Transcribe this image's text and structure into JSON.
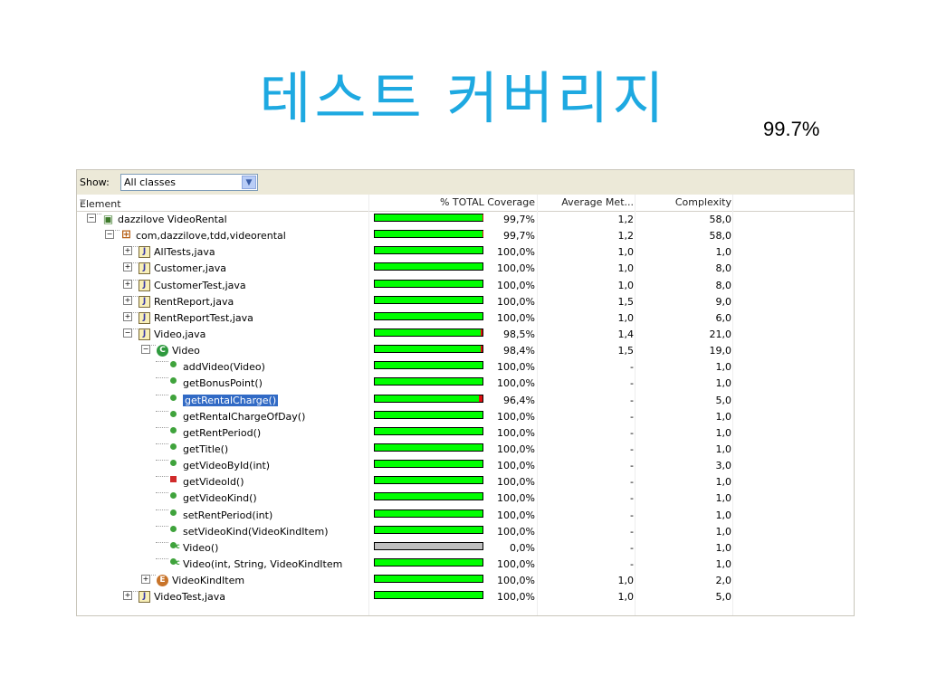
{
  "title": "테스트 커버리지",
  "overall_coverage": "99.7%",
  "show": {
    "label": "Show:",
    "value": "All classes",
    "dropdown_icon": "chevron-down-icon"
  },
  "columns": {
    "element": "Element",
    "coverage": "% TOTAL Coverage",
    "average": "Average Met...",
    "complexity": "Complexity"
  },
  "colors": {
    "title": "#1ea9e1",
    "covered": "#00ff00",
    "missed": "#dd1111",
    "not_covered": "#c0c0c0",
    "selection": "#316ac5"
  },
  "rows": [
    {
      "name": "dazzilove VideoRental",
      "icon": "project-icon",
      "level": 0,
      "expander": "minus",
      "coverage_value": 99.7,
      "coverage": "99,7%",
      "average": "1,2",
      "complexity": "58,0"
    },
    {
      "name": "com,dazzilove,tdd,videorental",
      "icon": "package-icon",
      "level": 1,
      "expander": "minus",
      "coverage_value": 99.7,
      "coverage": "99,7%",
      "average": "1,2",
      "complexity": "58,0"
    },
    {
      "name": "AllTests,java",
      "icon": "java-file-icon",
      "level": 2,
      "expander": "plus",
      "coverage_value": 100,
      "coverage": "100,0%",
      "average": "1,0",
      "complexity": "1,0"
    },
    {
      "name": "Customer,java",
      "icon": "java-file-icon",
      "level": 2,
      "expander": "plus",
      "coverage_value": 100,
      "coverage": "100,0%",
      "average": "1,0",
      "complexity": "8,0"
    },
    {
      "name": "CustomerTest,java",
      "icon": "java-file-icon",
      "level": 2,
      "expander": "plus",
      "coverage_value": 100,
      "coverage": "100,0%",
      "average": "1,0",
      "complexity": "8,0"
    },
    {
      "name": "RentReport,java",
      "icon": "java-file-icon",
      "level": 2,
      "expander": "plus",
      "coverage_value": 100,
      "coverage": "100,0%",
      "average": "1,5",
      "complexity": "9,0"
    },
    {
      "name": "RentReportTest,java",
      "icon": "java-file-icon",
      "level": 2,
      "expander": "plus",
      "coverage_value": 100,
      "coverage": "100,0%",
      "average": "1,0",
      "complexity": "6,0"
    },
    {
      "name": "Video,java",
      "icon": "java-file-icon",
      "level": 2,
      "expander": "minus",
      "coverage_value": 98.5,
      "coverage": "98,5%",
      "average": "1,4",
      "complexity": "21,0"
    },
    {
      "name": "Video",
      "icon": "class-icon",
      "level": 3,
      "expander": "minus",
      "coverage_value": 98.4,
      "coverage": "98,4%",
      "average": "1,5",
      "complexity": "19,0"
    },
    {
      "name": "addVideo(Video)",
      "icon": "public-method-icon",
      "level": 4,
      "coverage_value": 100,
      "coverage": "100,0%",
      "average": "-",
      "complexity": "1,0"
    },
    {
      "name": "getBonusPoint()",
      "icon": "public-method-icon",
      "level": 4,
      "coverage_value": 100,
      "coverage": "100,0%",
      "average": "-",
      "complexity": "1,0"
    },
    {
      "name": "getRentalCharge()",
      "icon": "public-method-icon",
      "level": 4,
      "selected": true,
      "coverage_value": 96.4,
      "coverage": "96,4%",
      "average": "-",
      "complexity": "5,0"
    },
    {
      "name": "getRentalChargeOfDay()",
      "icon": "public-method-icon",
      "level": 4,
      "coverage_value": 100,
      "coverage": "100,0%",
      "average": "-",
      "complexity": "1,0"
    },
    {
      "name": "getRentPeriod()",
      "icon": "public-method-icon",
      "level": 4,
      "coverage_value": 100,
      "coverage": "100,0%",
      "average": "-",
      "complexity": "1,0"
    },
    {
      "name": "getTitle()",
      "icon": "public-method-icon",
      "level": 4,
      "coverage_value": 100,
      "coverage": "100,0%",
      "average": "-",
      "complexity": "1,0"
    },
    {
      "name": "getVideoById(int)",
      "icon": "public-method-icon",
      "level": 4,
      "coverage_value": 100,
      "coverage": "100,0%",
      "average": "-",
      "complexity": "3,0"
    },
    {
      "name": "getVideold()",
      "icon": "private-method-icon",
      "level": 4,
      "coverage_value": 100,
      "coverage": "100,0%",
      "average": "-",
      "complexity": "1,0"
    },
    {
      "name": "getVideoKind()",
      "icon": "public-method-icon",
      "level": 4,
      "coverage_value": 100,
      "coverage": "100,0%",
      "average": "-",
      "complexity": "1,0"
    },
    {
      "name": "setRentPeriod(int)",
      "icon": "public-method-icon",
      "level": 4,
      "coverage_value": 100,
      "coverage": "100,0%",
      "average": "-",
      "complexity": "1,0"
    },
    {
      "name": "setVideoKind(VideoKindItem)",
      "icon": "public-method-icon",
      "level": 4,
      "coverage_value": 100,
      "coverage": "100,0%",
      "average": "-",
      "complexity": "1,0"
    },
    {
      "name": "Video()",
      "icon": "constructor-icon",
      "level": 4,
      "coverage_value": 0,
      "coverage": "0,0%",
      "average": "-",
      "complexity": "1,0"
    },
    {
      "name": "Video(int, String, VideoKindItem",
      "icon": "constructor-icon",
      "level": 4,
      "coverage_value": 100,
      "coverage": "100,0%",
      "average": "-",
      "complexity": "1,0"
    },
    {
      "name": "VideoKindItem",
      "icon": "enum-icon",
      "level": 3,
      "expander": "plus",
      "coverage_value": 100,
      "coverage": "100,0%",
      "average": "1,0",
      "complexity": "2,0"
    },
    {
      "name": "VideoTest,java",
      "icon": "java-file-icon",
      "level": 2,
      "expander": "plus",
      "coverage_value": 100,
      "coverage": "100,0%",
      "average": "1,0",
      "complexity": "5,0"
    }
  ]
}
